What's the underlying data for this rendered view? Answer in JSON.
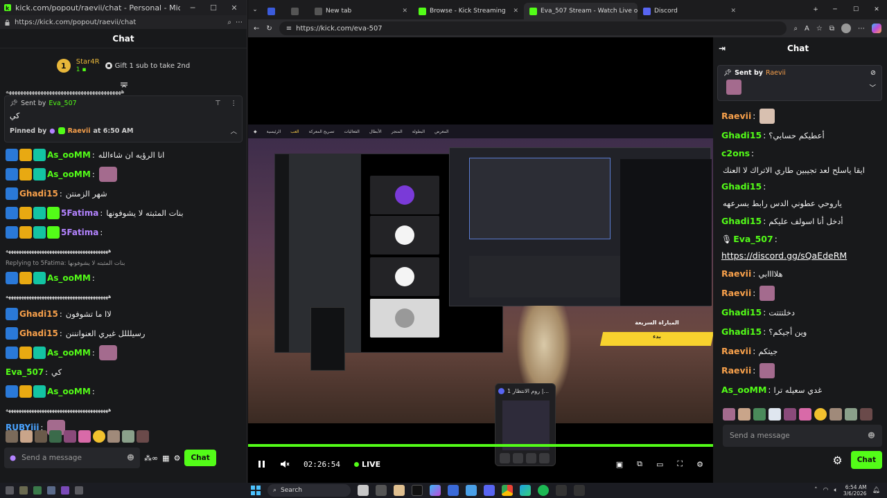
{
  "left_window": {
    "title": "kick.com/popout/raevii/chat - Personal - Microsoft Edge",
    "url": "https://kick.com/popout/raevii/chat",
    "header": "Chat",
    "gifter": {
      "rank": "1",
      "name": "Star4R",
      "count": "1",
      "cta": "Gift 1 sub to take 2nd"
    },
    "pin": {
      "sent_by_prefix": "Sent by",
      "sender": "Eva_507",
      "message": "كي",
      "pinned_by_prefix": "Pinned by",
      "pinned_by": "Raevii",
      "pinned_at": "at 6:50 AM"
    },
    "messages": [
      {
        "user": "As_ooMM",
        "color": "#53fc18",
        "text": "انا الرؤيه ان شاءالله",
        "badges": [
          "b-blue",
          "b-gold",
          "b-teal"
        ]
      },
      {
        "user": "As_ooMM",
        "color": "#53fc18",
        "text": "",
        "badges": [
          "b-blue",
          "b-gold",
          "b-teal"
        ],
        "emote": true
      },
      {
        "user": "Ghadi15",
        "color": "#f7a04b",
        "text": "شهر الزمنتن",
        "badges": [
          "b-blue"
        ]
      },
      {
        "user": "5Fatima",
        "color": "#b383ff",
        "text": "بنات المثبته لا يشوفونها",
        "badges": [
          "b-blue",
          "b-gold",
          "b-teal",
          "b-green"
        ]
      },
      {
        "user": "5Fatima",
        "color": "#b383ff",
        "text": "",
        "badges": [
          "b-blue",
          "b-gold",
          "b-teal",
          "b-green"
        ]
      },
      {
        "user": "",
        "color": "#ffffff",
        "text": "ههههههههههههههههههههههههههههههههههههههههه",
        "badges": []
      },
      {
        "user": "As_ooMM",
        "color": "#53fc18",
        "text": "",
        "badges": [
          "b-blue",
          "b-gold",
          "b-teal"
        ]
      },
      {
        "user": "",
        "color": "#ffffff",
        "text": "ههههههههههههههههههههههههههههههههههههههههه",
        "badges": []
      },
      {
        "user": "Ghadi15",
        "color": "#f7a04b",
        "text": "لاا ما تشوفون",
        "badges": [
          "b-blue"
        ]
      },
      {
        "user": "Ghadi15",
        "color": "#f7a04b",
        "text": "رسيلللل غيري العنوانننن",
        "badges": [
          "b-blue"
        ]
      },
      {
        "user": "As_ooMM",
        "color": "#53fc18",
        "text": "",
        "badges": [
          "b-blue",
          "b-gold",
          "b-teal"
        ],
        "emote": true
      },
      {
        "user": "Eva_507",
        "color": "#53fc18",
        "text": "كي",
        "badges": []
      },
      {
        "user": "As_ooMM",
        "color": "#53fc18",
        "text": "",
        "badges": [
          "b-blue",
          "b-gold",
          "b-teal"
        ]
      },
      {
        "user": "",
        "color": "#ffffff",
        "text": "ههههههههههههههههههههههههههههههههههههههههه",
        "badges": []
      },
      {
        "user": "RUBYiii",
        "color": "#4aa3ff",
        "text": "",
        "badges": [],
        "emote": true
      }
    ],
    "reply_note": "Replying to 5Fatima: بنات المثبته لا يشوفونها",
    "input_placeholder": "Send a message",
    "chat_button": "Chat"
  },
  "browser": {
    "tabs": [
      {
        "label": "",
        "active": false,
        "color": "#3b5bdb"
      },
      {
        "label": "",
        "active": false,
        "color": "#555555"
      },
      {
        "label": "New tab",
        "active": false,
        "color": "#555555"
      },
      {
        "label": "Browse - Kick Streaming",
        "active": false,
        "color": "#53fc18"
      },
      {
        "label": "Eva_507 Stream - Watch Live on Kick",
        "active": true,
        "color": "#53fc18"
      },
      {
        "label": "Discord",
        "active": false,
        "color": "#5865f2"
      }
    ],
    "url": "https://kick.com/eva-507"
  },
  "player": {
    "time": "02:26:54",
    "live": "LIVE",
    "game_nav": [
      "الرئيسية",
      "العب",
      "تصريح المعركة",
      "الفعاليات",
      "الأبطال",
      "المتجر",
      "البطولة",
      "المعرض"
    ],
    "game_nav_active": 1,
    "quick_title": "المباراة السريعة",
    "quick_button": "بدء",
    "pip_title": "روم الانتظار 1 |..."
  },
  "right_chat": {
    "header": "Chat",
    "pin": {
      "sent_by_prefix": "Sent by",
      "sender": "Raevii"
    },
    "messages": [
      {
        "user": "Raevii",
        "color": "#f7a04b",
        "text": "",
        "emote": true
      },
      {
        "user": "Ghadi15",
        "color": "#53fc18",
        "text": "أعطيكم حسابي؟"
      },
      {
        "user": "c2ons",
        "color": "#53fc18",
        "text": "ايقا ياسلح لعد تجيبين طاري الاتراك لا العنك"
      },
      {
        "user": "Ghadi15",
        "color": "#53fc18",
        "text": "ياروحي عطوني الدس رابط بسرعهه"
      },
      {
        "user": "Ghadi15",
        "color": "#53fc18",
        "text": "أدخل أنا اسولف عليكم"
      },
      {
        "user": "Eva_507",
        "color": "#53fc18",
        "text": "",
        "link": "https://discord.gg/sQaEdeRM"
      },
      {
        "user": "Raevii",
        "color": "#f7a04b",
        "text": "هلاااابي"
      },
      {
        "user": "Raevii",
        "color": "#f7a04b",
        "text": "",
        "emote": true
      },
      {
        "user": "Ghadi15",
        "color": "#53fc18",
        "text": "دخلتتتت"
      },
      {
        "user": "Ghadi15",
        "color": "#53fc18",
        "text": "وين أجيكم؟"
      },
      {
        "user": "Raevii",
        "color": "#f7a04b",
        "text": "جيتكم"
      },
      {
        "user": "Raevii",
        "color": "#f7a04b",
        "text": "",
        "emote": true
      },
      {
        "user": "As_ooMM",
        "color": "#53fc18",
        "text": "غدي سعيله ترا"
      }
    ],
    "input_placeholder": "Send a message",
    "chat_button": "Chat"
  },
  "taskbar": {
    "search": "Search",
    "time": "6:54 AM",
    "date": "3/6/2026"
  }
}
